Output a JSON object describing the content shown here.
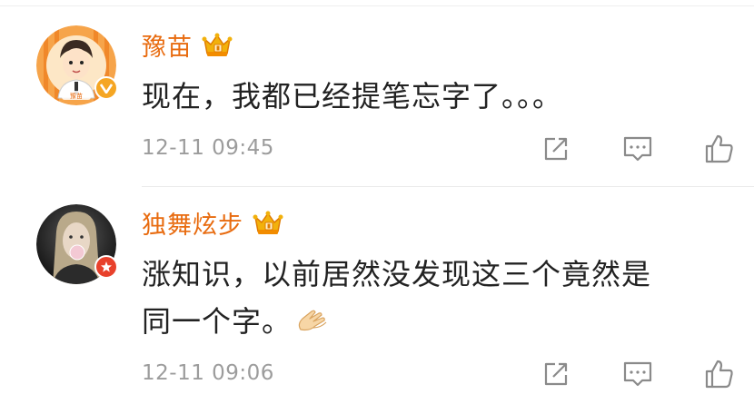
{
  "comments": [
    {
      "username": "豫苗",
      "text": "现在，我都已经提笔忘字了。。。",
      "timestamp": "12-11 09:45",
      "avatar_icon": "cartoon-boy-avatar",
      "badge_icon": "verified-v-icon",
      "badge_color": "#f5a623",
      "crown_icon": "crown-membership-icon",
      "avatar_label": "豫苗"
    },
    {
      "username": "独舞炫步",
      "text_line1": "涨知识，以前居然没发现这三个竟然是",
      "text_line2": "同一个字。",
      "timestamp": "12-11 09:06",
      "avatar_icon": "girl-photo-avatar",
      "badge_icon": "red-badge-icon",
      "badge_color": "#e8412c",
      "crown_icon": "crown-membership-icon",
      "emoji_icon": "clapping-hands-emoji"
    }
  ],
  "colors": {
    "username": "#e86b0f",
    "text": "#222222",
    "timestamp": "#9c9c9c",
    "icon": "#8a8a8a",
    "crown": "#f2b10c"
  }
}
